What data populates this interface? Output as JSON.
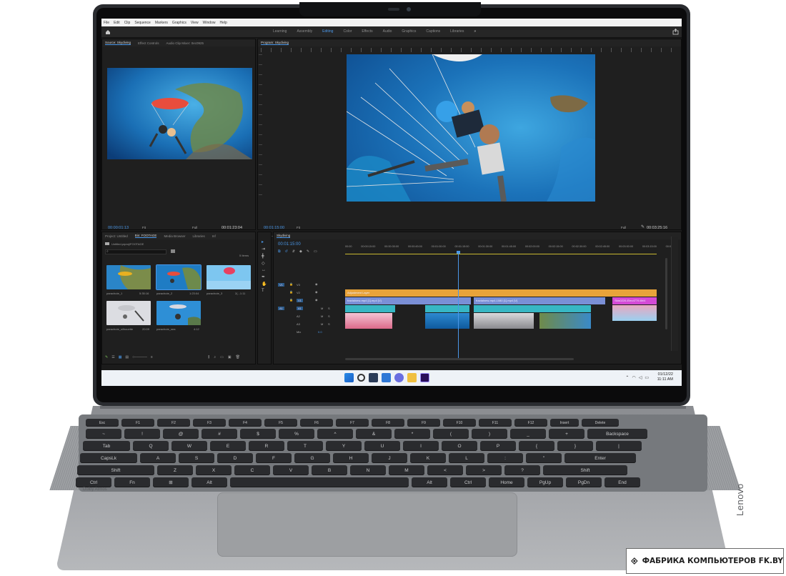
{
  "app": {
    "menu": [
      "File",
      "Edit",
      "Clip",
      "Sequence",
      "Markers",
      "Graphics",
      "View",
      "Window",
      "Help"
    ],
    "workspaces": [
      "Learning",
      "Assembly",
      "Editing",
      "Color",
      "Effects",
      "Audio",
      "Graphics",
      "Captions",
      "Libraries"
    ],
    "active_workspace": "Editing",
    "more_workspaces_glyph": "»"
  },
  "source_panel": {
    "tabs": [
      "Source: Skydiving",
      "Effect Controls",
      "Audio Clip Mixer: 0ec0925"
    ],
    "timecode_in": "00:00:01:13",
    "fit_select": "Fit",
    "quality_select": "Full",
    "timecode_duration": "00:01:23:04"
  },
  "program_panel": {
    "tab": "Program: Skydiving",
    "timecode_in": "00:01:15:00",
    "fit_select": "Fit",
    "quality_select": "Full",
    "timecode_duration": "00:03:25:16"
  },
  "project_panel": {
    "tabs": [
      "Project: Untitled",
      "Bin: FOOTAGE",
      "Media Browser",
      "Libraries",
      "Inf"
    ],
    "path": "Untitled.prproj\\FOOTAGE",
    "items_count": "5 Items",
    "clips": [
      {
        "name": "parachute_1",
        "duration": "5:35:16"
      },
      {
        "name": "parachute_2",
        "duration": "1:23:04"
      },
      {
        "name": "parachute_3",
        "duration": "2(...1:11"
      },
      {
        "name": "parachute_silhouette",
        "duration": "20:09"
      },
      {
        "name": "parachute_sea",
        "duration": "4:12"
      }
    ]
  },
  "timeline": {
    "tab": "Skydiving",
    "timecode": "00:01:15:00",
    "ruler": [
      "00:00",
      "00:00:15:00",
      "00:00:30:00",
      "00:00:45:00",
      "00:01:00:00",
      "00:01:15:00",
      "00:01:30:00",
      "00:01:45:00",
      "00:02:00:00",
      "00:02:15:00",
      "00:02:30:00",
      "00:02:45:00",
      "00:03:00:00",
      "00:03:15:00",
      "00:0"
    ],
    "video_tracks": [
      "V3",
      "V2",
      "V1"
    ],
    "audio_tracks": [
      "A1",
      "A2",
      "A3"
    ],
    "mix_label": "Mix",
    "mix_value": "0.0",
    "clips": {
      "adjustment": "Adjustment Layer",
      "v2_a": "fractalnew-mp4 [1].mp4 [V]",
      "v2_b": "fractalnew-mp4-1080 [1].mp4 [V]",
      "v2_c": "Skis0226-Elec4779-6hl4"
    }
  },
  "taskbar": {
    "time": "11:11 AM",
    "date": "01/12/22"
  },
  "keyboard": {
    "row_fn": [
      "Esc",
      "F1",
      "F2",
      "F3",
      "F4",
      "F5",
      "F6",
      "F7",
      "F8",
      "F9",
      "F10",
      "F11",
      "F12",
      "Insert",
      "Delete"
    ],
    "row_num": [
      "~",
      "!",
      "@",
      "#",
      "$",
      "%",
      "^",
      "&",
      "*",
      "(",
      ")",
      "_",
      "+",
      "Backspace"
    ],
    "row_tab": [
      "Tab",
      "Q",
      "W",
      "E",
      "R",
      "T",
      "Y",
      "U",
      "I",
      "O",
      "P",
      "{",
      "}",
      "|"
    ],
    "row_caps": [
      "CapsLk",
      "A",
      "S",
      "D",
      "F",
      "G",
      "H",
      "J",
      "K",
      "L",
      ":",
      "\"",
      "Enter"
    ],
    "row_shift": [
      "Shift",
      "Z",
      "X",
      "C",
      "V",
      "B",
      "N",
      "M",
      "<",
      ">",
      "?",
      "Shift"
    ],
    "row_ctrl": [
      "Ctrl",
      "Fn",
      "⊞",
      "Alt",
      "",
      "Alt",
      "Ctrl",
      "Home",
      "PgUp",
      "PgDn",
      "End"
    ],
    "audio_brand": "Dolby Atmos"
  },
  "device_brand": "Lenovo",
  "watermark": "ФАБРИКА КОМПЬЮТЕРОВ FK.BY",
  "colors": {
    "accent": "#4a97e8",
    "adjustment_clip": "#e8a33a",
    "video_clip": "#7a8fd6",
    "audio_clip": "#37b7c4",
    "pink_clip": "#d44ad6"
  }
}
